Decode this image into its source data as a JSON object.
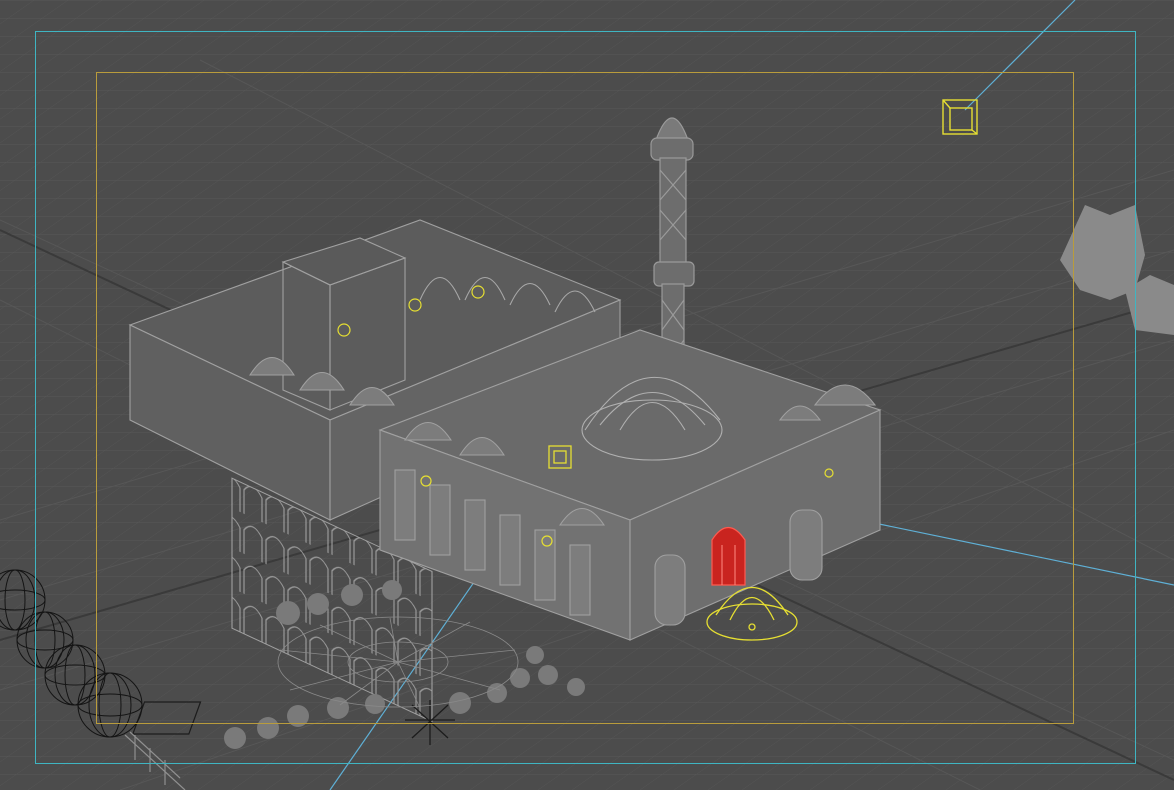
{
  "viewport": {
    "view_type": "perspective",
    "render_style": "wireframe",
    "colors": {
      "background": "#4c4c4c",
      "grid": "#5a5a5a",
      "wire": "#9a9a9a",
      "selected": "#d62a2a",
      "light_helper": "#e6df32",
      "safe_frame": "#3fb5c2",
      "action_frame": "#b99c3c",
      "camera_line": "#5fb0d6"
    }
  },
  "scene": {
    "objects": [
      {
        "name": "mosque-model",
        "icon": "building-wireframe"
      },
      {
        "name": "minaret",
        "icon": "tower-wireframe"
      },
      {
        "name": "main-dome",
        "icon": "dome-wireframe"
      },
      {
        "name": "selected-door",
        "icon": "door-selected"
      },
      {
        "name": "sky-dome-light",
        "icon": "dome-light-icon"
      },
      {
        "name": "camera-target",
        "icon": "camera-target-icon"
      },
      {
        "name": "sun-light",
        "icon": "sun-light-icon"
      },
      {
        "name": "tree-proxy",
        "icon": "tree-icon"
      },
      {
        "name": "shrub-group",
        "icon": "shrub-icon"
      }
    ]
  }
}
